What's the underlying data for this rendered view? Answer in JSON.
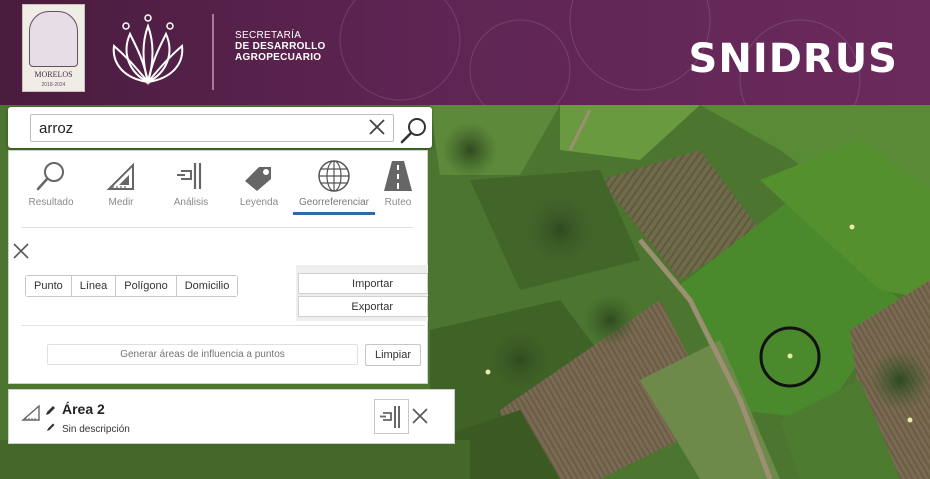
{
  "header": {
    "shield_caption": "MORELOS",
    "shield_years": "2018-2024",
    "secretaria_l1": "SECRETARÍA",
    "secretaria_l2": "DE DESARROLLO",
    "secretaria_l3": "AGROPECUARIO",
    "brand": "SNIDRUS"
  },
  "search": {
    "value": "arroz"
  },
  "tabs": [
    {
      "label": "Resultado",
      "icon": "magnifier-icon",
      "active": false
    },
    {
      "label": "Medir",
      "icon": "ruler-triangle-icon",
      "active": false
    },
    {
      "label": "Análisis",
      "icon": "analysis-icon",
      "active": false
    },
    {
      "label": "Leyenda",
      "icon": "tag-icon",
      "active": false
    },
    {
      "label": "Georreferenciar",
      "icon": "globe-icon",
      "active": true
    },
    {
      "label": "Ruteo",
      "icon": "road-icon",
      "active": false
    }
  ],
  "draw_buttons": [
    "Punto",
    "Línea",
    "Polígono",
    "Domicilio"
  ],
  "io": {
    "import_label": "Importar",
    "export_label": "Exportar"
  },
  "buffer": {
    "placeholder": "Generar áreas de influencia a puntos",
    "clear_label": "Limpiar"
  },
  "area": {
    "title": "Área 2",
    "description": "Sin descripción"
  },
  "colors": {
    "header_bg": "#5e2553",
    "active_tab_underline": "#2a6aa8"
  }
}
